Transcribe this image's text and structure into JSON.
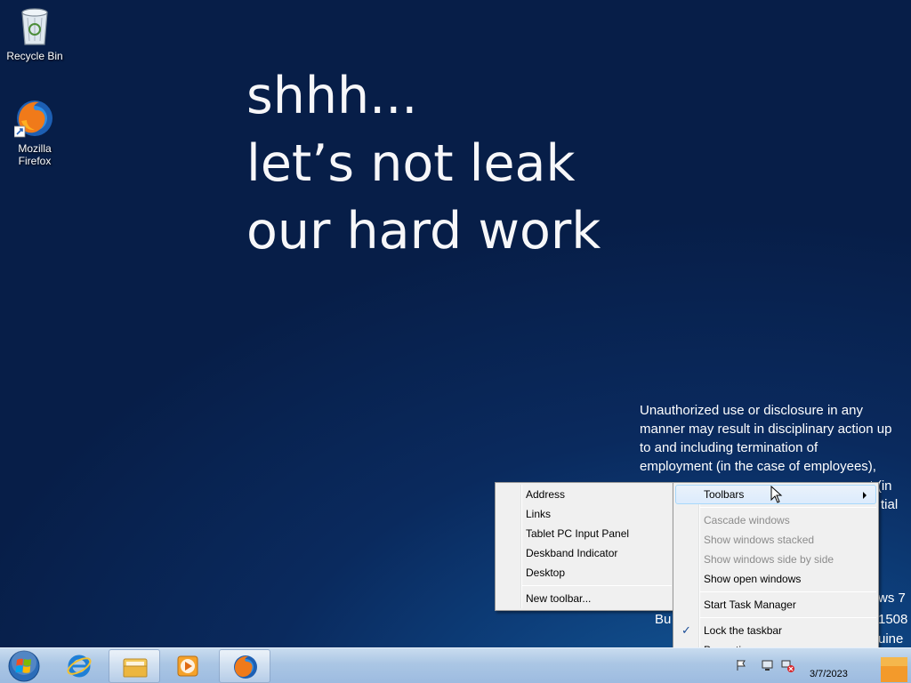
{
  "desktop": {
    "icons": [
      {
        "label": "Recycle Bin",
        "icon": "recycle-bin-icon"
      },
      {
        "label_line1": "Mozilla",
        "label_line2": "Firefox",
        "icon": "firefox-icon"
      }
    ],
    "wallpaper_lines": [
      "shhh...",
      "let’s not leak",
      "our hard work"
    ],
    "legal_lines": [
      "Unauthorized use or disclosure in any",
      "manner may result in disciplinary action up",
      "to and including termination of",
      "employment (in the case of employees),"
    ],
    "legal_fragments": {
      "f1": "ct (in",
      "f2": "tial",
      "f3": "ws 7",
      "f4": "Bu",
      "f5": "1508",
      "f6": "uine"
    }
  },
  "context_menu": {
    "items": [
      {
        "label": "Toolbars",
        "has_submenu": true
      },
      {
        "label": "Cascade windows",
        "disabled": true
      },
      {
        "label": "Show windows stacked",
        "disabled": true
      },
      {
        "label": "Show windows side by side",
        "disabled": true
      },
      {
        "label": "Show open windows"
      },
      {
        "label": "Start Task Manager"
      },
      {
        "label": "Lock the taskbar",
        "checked": true
      },
      {
        "label": "Properties"
      }
    ]
  },
  "toolbars_submenu": {
    "items": [
      {
        "label": "Address"
      },
      {
        "label": "Links"
      },
      {
        "label": "Tablet PC Input Panel"
      },
      {
        "label": "Deskband Indicator"
      },
      {
        "label": "Desktop"
      },
      {
        "label": "New toolbar..."
      }
    ]
  },
  "taskbar": {
    "pinned": [
      "internet-explorer-icon",
      "windows-explorer-icon",
      "media-player-icon",
      "firefox-icon"
    ],
    "clock_date": "3/7/2023"
  }
}
